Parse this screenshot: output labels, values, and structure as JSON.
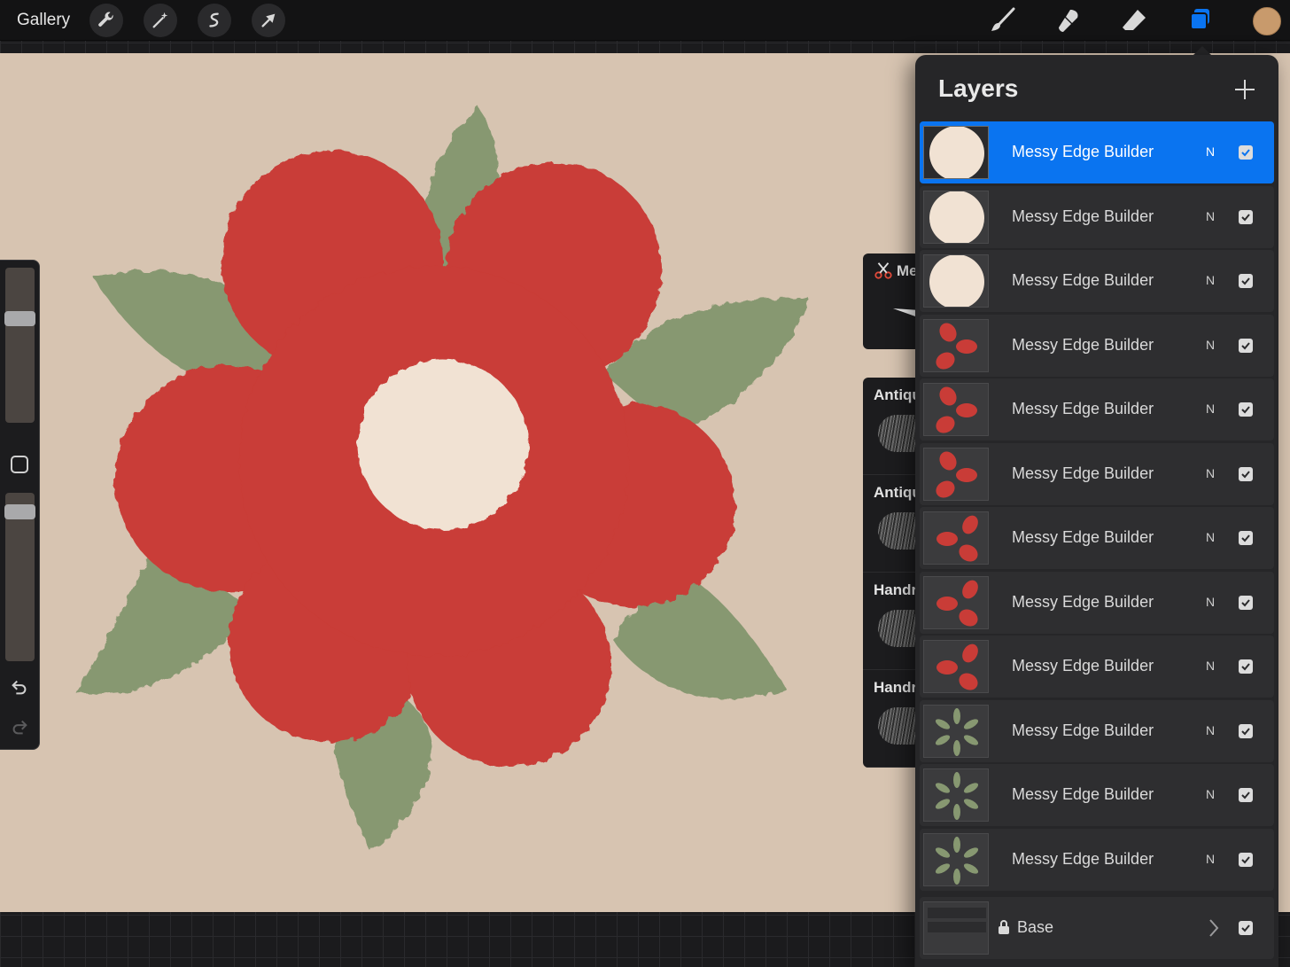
{
  "topbar": {
    "gallery_label": "Gallery",
    "left_tools": [
      "wrench-icon",
      "magic-wand-icon",
      "selection-icon",
      "transform-arrow-icon"
    ],
    "right_tools": [
      "brush-icon",
      "smudge-icon",
      "eraser-icon",
      "layers-icon"
    ],
    "active_tool": "layers-icon",
    "accent_color": "#0a74f0"
  },
  "canvas": {
    "background_color": "#d7c4b1",
    "colors": {
      "petal": "#c93c37",
      "leaf": "#879871",
      "center": "#f1e2d3"
    }
  },
  "brush_library": {
    "header_label": "Me",
    "items": [
      {
        "label": "Antiqu"
      },
      {
        "label": "Antiqu"
      },
      {
        "label": "Handr"
      },
      {
        "label": "Handr"
      }
    ]
  },
  "layers_panel": {
    "title": "Layers",
    "layers": [
      {
        "name": "Messy Edge Builder",
        "blend": "N",
        "visible": true,
        "selected": true,
        "thumb": "circle"
      },
      {
        "name": "Messy Edge Builder",
        "blend": "N",
        "visible": true,
        "selected": false,
        "thumb": "circle"
      },
      {
        "name": "Messy Edge Builder",
        "blend": "N",
        "visible": true,
        "selected": false,
        "thumb": "circle"
      },
      {
        "name": "Messy Edge Builder",
        "blend": "N",
        "visible": true,
        "selected": false,
        "thumb": "petals-a"
      },
      {
        "name": "Messy Edge Builder",
        "blend": "N",
        "visible": true,
        "selected": false,
        "thumb": "petals-a"
      },
      {
        "name": "Messy Edge Builder",
        "blend": "N",
        "visible": true,
        "selected": false,
        "thumb": "petals-a"
      },
      {
        "name": "Messy Edge Builder",
        "blend": "N",
        "visible": true,
        "selected": false,
        "thumb": "petals-b"
      },
      {
        "name": "Messy Edge Builder",
        "blend": "N",
        "visible": true,
        "selected": false,
        "thumb": "petals-b"
      },
      {
        "name": "Messy Edge Builder",
        "blend": "N",
        "visible": true,
        "selected": false,
        "thumb": "petals-b"
      },
      {
        "name": "Messy Edge Builder",
        "blend": "N",
        "visible": true,
        "selected": false,
        "thumb": "leaves"
      },
      {
        "name": "Messy Edge Builder",
        "blend": "N",
        "visible": true,
        "selected": false,
        "thumb": "leaves"
      },
      {
        "name": "Messy Edge Builder",
        "blend": "N",
        "visible": true,
        "selected": false,
        "thumb": "leaves"
      }
    ],
    "base": {
      "name": "Base",
      "visible": true,
      "locked": true
    }
  }
}
